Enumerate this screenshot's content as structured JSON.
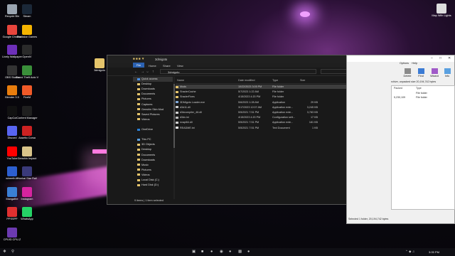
{
  "desktop": {
    "icons_left": [
      {
        "label": "Recycle Bin",
        "color": "#9aa4b0"
      },
      {
        "label": "Google Chrome",
        "color": "#e8453c"
      },
      {
        "label": "Lively Wallpaper",
        "color": "#6d2fb8"
      },
      {
        "label": "OBS Studio",
        "color": "#333333"
      },
      {
        "label": "Blender 3.5",
        "color": "#e87d0d"
      },
      {
        "label": "CapCut",
        "color": "#111111"
      },
      {
        "label": "Discord",
        "color": "#5865f2"
      },
      {
        "label": "YouTube",
        "color": "#ff0000"
      },
      {
        "label": "wineeth.tfr",
        "color": "#2c5fd0"
      },
      {
        "label": "Mangafire",
        "color": "#3a7fd5"
      },
      {
        "label": "PPSSPP",
        "color": "#e03030"
      },
      {
        "label": "CPUID CPU-Z",
        "color": "#6c3ab0"
      }
    ],
    "icons_col2": [
      {
        "label": "Steam",
        "color": "#1b2838"
      },
      {
        "label": "Rockstar Games",
        "color": "#f4b400"
      },
      {
        "label": "OpenIV",
        "color": "#2a2a2a"
      },
      {
        "label": "Grand Theft Auto V",
        "color": "#3a8f3a"
      },
      {
        "label": "FiveM",
        "color": "#f05a28"
      },
      {
        "label": "Content Manager",
        "color": "#1f1f1f"
      },
      {
        "label": "Assetto Corsa",
        "color": "#cc2222"
      },
      {
        "label": "Genshin Impact",
        "color": "#d9c48a"
      },
      {
        "label": "Honkai Star Rail",
        "color": "#3a3a7a"
      },
      {
        "label": "Instagram",
        "color": "#d6249f"
      },
      {
        "label": "WhatsApp",
        "color": "#25d366"
      }
    ],
    "extra_icon": {
      "label": "3dmigoto",
      "color": "#e5c46b"
    },
    "right_icon": {
      "label": "Map With Lights",
      "color": "#dddddd"
    }
  },
  "explorer": {
    "title": "3dmigoto",
    "tabs": [
      "File",
      "Home",
      "Share",
      "View"
    ],
    "address": "3dmigoto",
    "search_placeholder": "Search 3dmigoto",
    "nav_items": [
      {
        "label": "Quick access",
        "selected": true
      },
      {
        "label": "Desktop"
      },
      {
        "label": "Downloads"
      },
      {
        "label": "Documents"
      },
      {
        "label": "Pictures"
      },
      {
        "label": "Captures"
      },
      {
        "label": "Genshin Skin Mod"
      },
      {
        "label": "Saved Pictures"
      },
      {
        "label": "Videos"
      },
      {
        "label": ""
      },
      {
        "label": "OneDrive"
      },
      {
        "label": ""
      },
      {
        "label": "This PC"
      },
      {
        "label": "3D Objects"
      },
      {
        "label": "Desktop"
      },
      {
        "label": "Documents"
      },
      {
        "label": "Downloads"
      },
      {
        "label": "Music"
      },
      {
        "label": "Pictures"
      },
      {
        "label": "Videos"
      },
      {
        "label": "Local Disk (C:)"
      },
      {
        "label": "Hard Disk (D:)"
      }
    ],
    "columns": {
      "name": "Name",
      "date": "Date modified",
      "type": "Type",
      "size": "Size"
    },
    "files": [
      {
        "name": "Mods",
        "date": "10/22/2023 3:05 PM",
        "type": "File folder",
        "size": "",
        "kind": "folder",
        "selected": true
      },
      {
        "name": "ShaderCache",
        "date": "5/7/2023 1:22 AM",
        "type": "File folder",
        "size": "",
        "kind": "folder"
      },
      {
        "name": "ShaderFixes",
        "date": "4/15/2023 4:20 PM",
        "type": "File folder",
        "size": "",
        "kind": "folder"
      },
      {
        "name": "3DMigoto Loader.exe",
        "date": "5/6/2023 1:28 AM",
        "type": "Application",
        "size": "29 KB",
        "kind": "exe"
      },
      {
        "name": "d3d11.dll",
        "date": "3/17/2023 12:07 AM",
        "type": "Application exte...",
        "size": "3,245 KB",
        "kind": "dll"
      },
      {
        "name": "d3dcompiler_46.dll",
        "date": "5/5/2021 7:51 PM",
        "type": "Application exte...",
        "size": "3,783 KB",
        "kind": "dll"
      },
      {
        "name": "d3dx.ini",
        "date": "4/15/2023 4:20 PM",
        "type": "Configuration sett...",
        "size": "17 KB",
        "kind": "ini"
      },
      {
        "name": "nvapi64.dll",
        "date": "5/5/2021 7:51 PM",
        "type": "Application exte...",
        "size": "181 KB",
        "kind": "dll"
      },
      {
        "name": "README.txt",
        "date": "5/5/2021 7:51 PM",
        "type": "Text Document",
        "size": "1 KB",
        "kind": "txt"
      }
    ],
    "status": "9 items   |   1 item selected"
  },
  "winrar": {
    "menu": [
      "Options",
      "Help"
    ],
    "tools": [
      "Delete",
      "Find",
      "Wizard",
      "Info"
    ],
    "info_line": "rchive, unpacked size 20,194,742 bytes",
    "headers": [
      "Packed",
      "Type"
    ],
    "rows": [
      {
        "packed": "",
        "type": "File folder"
      },
      {
        "packed": "5,230,109",
        "type": "File folder"
      }
    ],
    "status": "Selected 1 folder, 20,194,742 bytes"
  },
  "taskbar": {
    "time": "3:05 PM"
  }
}
